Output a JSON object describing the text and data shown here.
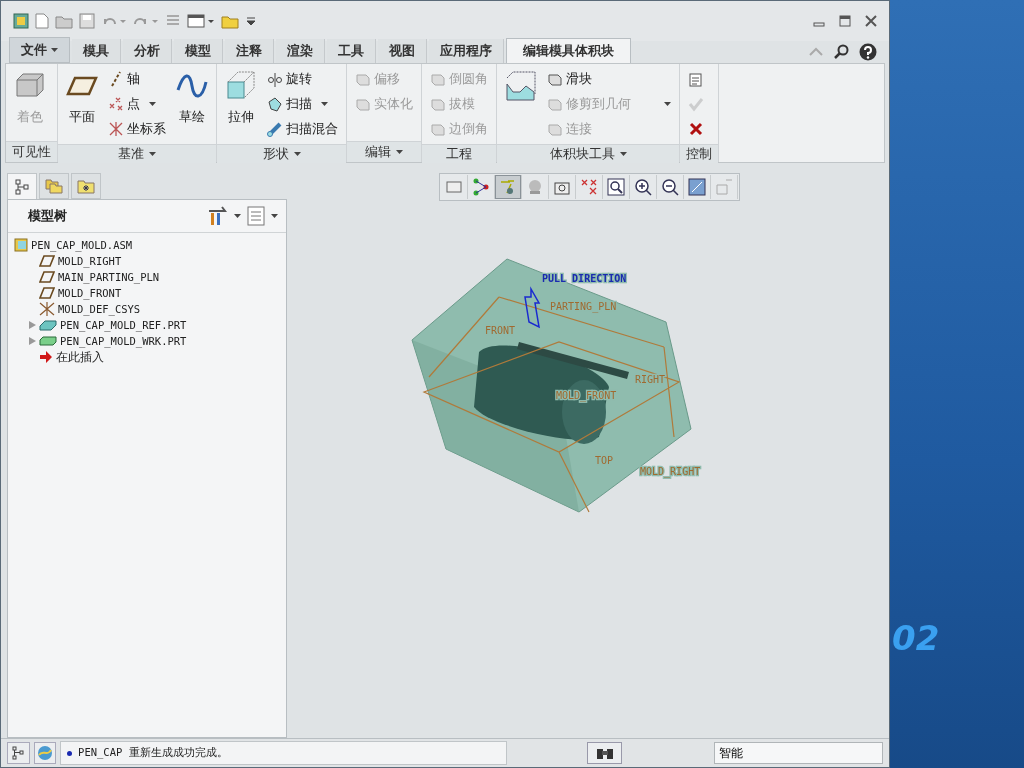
{
  "menu_tabs": [
    {
      "label": "文件",
      "kind": "file",
      "selected": false
    },
    {
      "label": "模具",
      "kind": "tab",
      "selected": false
    },
    {
      "label": "分析",
      "kind": "tab",
      "selected": false
    },
    {
      "label": "模型",
      "kind": "tab",
      "selected": false
    },
    {
      "label": "注释",
      "kind": "tab",
      "selected": false
    },
    {
      "label": "渲染",
      "kind": "tab",
      "selected": false
    },
    {
      "label": "工具",
      "kind": "tab",
      "selected": false
    },
    {
      "label": "视图",
      "kind": "tab",
      "selected": false
    },
    {
      "label": "应用程序",
      "kind": "tab",
      "selected": false
    },
    {
      "label": "编辑模具体积块",
      "kind": "tab",
      "selected": true
    }
  ],
  "ribbon_groups": [
    {
      "label": "可见性",
      "dropdown": false,
      "commands": [
        {
          "label": "着色",
          "kind": "large",
          "disabled": true
        }
      ]
    },
    {
      "label": "基准",
      "dropdown": true,
      "commands": [
        {
          "label": "平面",
          "kind": "large",
          "disabled": false
        },
        {
          "label": "轴",
          "kind": "small",
          "disabled": false
        },
        {
          "label": "点",
          "kind": "small",
          "disabled": false,
          "dropdown": true
        },
        {
          "label": "坐标系",
          "kind": "small",
          "disabled": false
        },
        {
          "label": "草绘",
          "kind": "large",
          "disabled": false
        }
      ]
    },
    {
      "label": "形状",
      "dropdown": true,
      "commands": [
        {
          "label": "拉伸",
          "kind": "large",
          "disabled": false
        },
        {
          "label": "旋转",
          "kind": "small",
          "disabled": false
        },
        {
          "label": "扫描",
          "kind": "small",
          "disabled": false,
          "dropdown": true
        },
        {
          "label": "扫描混合",
          "kind": "small",
          "disabled": false
        }
      ]
    },
    {
      "label": "编辑",
      "dropdown": true,
      "commands": [
        {
          "label": "偏移",
          "kind": "small",
          "disabled": true
        },
        {
          "label": "实体化",
          "kind": "small",
          "disabled": true
        }
      ]
    },
    {
      "label": "工程",
      "dropdown": false,
      "commands": [
        {
          "label": "倒圆角",
          "kind": "small",
          "disabled": true
        },
        {
          "label": "拔模",
          "kind": "small",
          "disabled": true
        },
        {
          "label": "边倒角",
          "kind": "small",
          "disabled": true
        }
      ]
    },
    {
      "label": "体积块工具",
      "dropdown": true,
      "commands": [
        {
          "kind": "large-icon",
          "disabled": false
        },
        {
          "label": "滑块",
          "kind": "small",
          "disabled": false
        },
        {
          "label": "修剪到几何",
          "kind": "small",
          "disabled": true,
          "dropdown": true
        },
        {
          "label": "连接",
          "kind": "small",
          "disabled": true
        }
      ]
    },
    {
      "label": "控制",
      "dropdown": false,
      "commands": [
        {
          "kind": "small-icon",
          "disabled": false
        },
        {
          "kind": "small-icon",
          "disabled": true
        },
        {
          "kind": "small-icon",
          "disabled": false
        }
      ]
    }
  ],
  "navigator_tabs": [
    {
      "selected": true
    },
    {
      "selected": false
    },
    {
      "selected": false
    }
  ],
  "model_tree": {
    "title": "模型树",
    "items": [
      {
        "label": "PEN_CAP_MOLD.ASM",
        "kind": "assembly",
        "children": [
          {
            "label": "MOLD_RIGHT",
            "kind": "plane"
          },
          {
            "label": "MAIN_PARTING_PLN",
            "kind": "plane"
          },
          {
            "label": "MOLD_FRONT",
            "kind": "plane"
          },
          {
            "label": "MOLD_DEF_CSYS",
            "kind": "csys"
          },
          {
            "label": "PEN_CAP_MOLD_REF.PRT",
            "kind": "ref-part",
            "expanded": false
          },
          {
            "label": "PEN_CAP_MOLD_WRK.PRT",
            "kind": "work-part",
            "expanded": false
          },
          {
            "label": "在此插入",
            "kind": "insert"
          }
        ]
      }
    ]
  },
  "view_toolbar": [
    {
      "selected": false
    },
    {
      "selected": false
    },
    {
      "selected": true
    },
    {
      "selected": false
    },
    {
      "selected": false
    },
    {
      "selected": false
    },
    {
      "selected": false
    },
    {
      "selected": false
    },
    {
      "selected": false
    },
    {
      "selected": false
    },
    {
      "selected": false
    }
  ],
  "model_view": {
    "labels": [
      {
        "text": "PULL DIRECTION",
        "kind": "direction"
      },
      {
        "text": "PARTING_PLN",
        "kind": "datum"
      },
      {
        "text": "FRONT",
        "kind": "datum"
      },
      {
        "text": "RIGHT",
        "kind": "datum"
      },
      {
        "text": "MOLD_FRONT",
        "kind": "datum"
      },
      {
        "text": "TOP",
        "kind": "datum"
      },
      {
        "text": "MOLD_RIGHT",
        "kind": "datum"
      }
    ]
  },
  "status_bar": {
    "message": "PEN_CAP 重新生成成功完成。",
    "filter": "智能"
  },
  "desktop": {
    "text": "02"
  }
}
